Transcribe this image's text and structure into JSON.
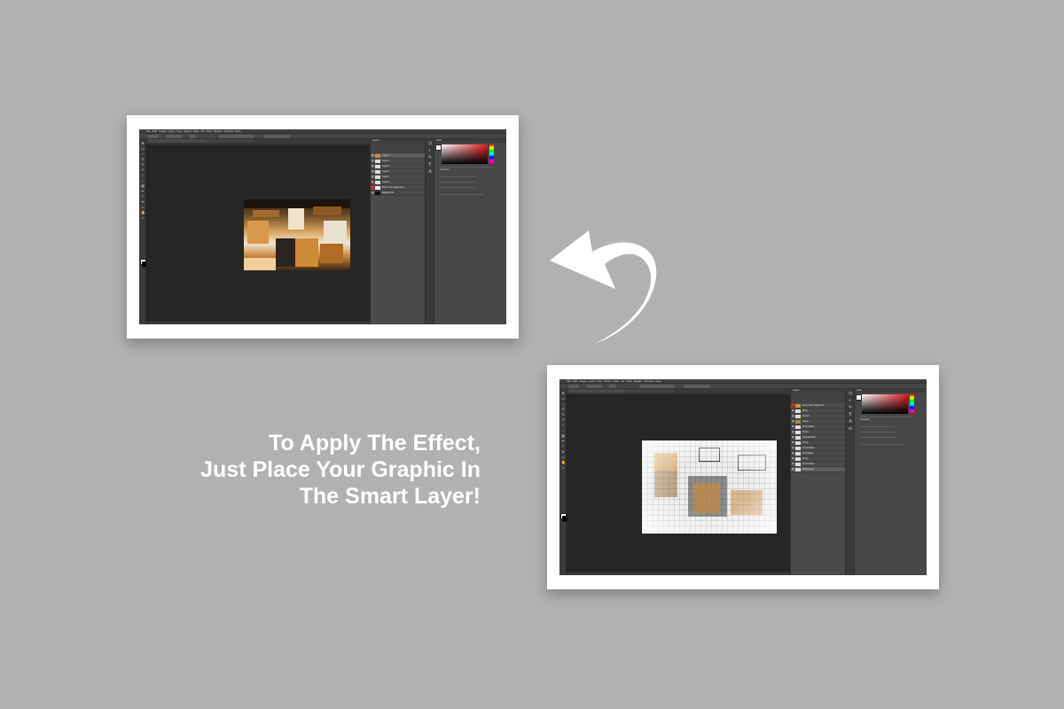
{
  "headline": {
    "line1": "To Apply The Effect,",
    "line2": "Just Place Your Graphic In",
    "line3": "The Smart Layer!"
  },
  "colors": {
    "background": "#b1b1b1",
    "frame": "#ffffff",
    "ps_workspace": "#282828",
    "ps_panel": "#4a4a4a",
    "arrow": "#ffffff",
    "headline": "#ffffff"
  },
  "icons": {
    "arrow": "curved-arrow-icon",
    "eye": "eye-icon"
  },
  "screens": {
    "before": {
      "menu": [
        "File",
        "Edit",
        "Image",
        "Layer",
        "Type",
        "Select",
        "Filter",
        "3D",
        "View",
        "Plugins",
        "Window",
        "Help"
      ],
      "layers_title": "Layers",
      "layers": [
        {
          "name": "Layer 1"
        },
        {
          "name": "Layer 2"
        },
        {
          "name": "Layer 3"
        },
        {
          "name": "Layer 4"
        },
        {
          "name": "Layer 5"
        },
        {
          "name": "Layer 6"
        },
        {
          "name": "Place Your Image Here"
        },
        {
          "name": "Background"
        }
      ],
      "panel_tabs": [
        "Color",
        "Swatches",
        "Gradients",
        "Patterns"
      ],
      "properties_title": "Properties"
    },
    "after": {
      "menu": [
        "File",
        "Edit",
        "Image",
        "Layer",
        "Type",
        "Select",
        "Filter",
        "3D",
        "View",
        "Plugins",
        "Window",
        "Help"
      ],
      "layers_title": "Layers",
      "layers": [
        {
          "name": "Place Your Image Here"
        },
        {
          "name": "Effect"
        },
        {
          "name": "Sketch"
        },
        {
          "name": "Group"
        },
        {
          "name": "Smart Filters"
        },
        {
          "name": "Stylize"
        },
        {
          "name": "Gaussian Blur"
        },
        {
          "name": "Group"
        },
        {
          "name": "Smart Filters"
        },
        {
          "name": "Find Edges"
        },
        {
          "name": "Group"
        },
        {
          "name": "Smart Filters"
        },
        {
          "name": "Background"
        }
      ],
      "panel_tabs": [
        "Color",
        "Swatches",
        "Gradients",
        "Patterns"
      ],
      "properties_title": "Properties"
    }
  }
}
